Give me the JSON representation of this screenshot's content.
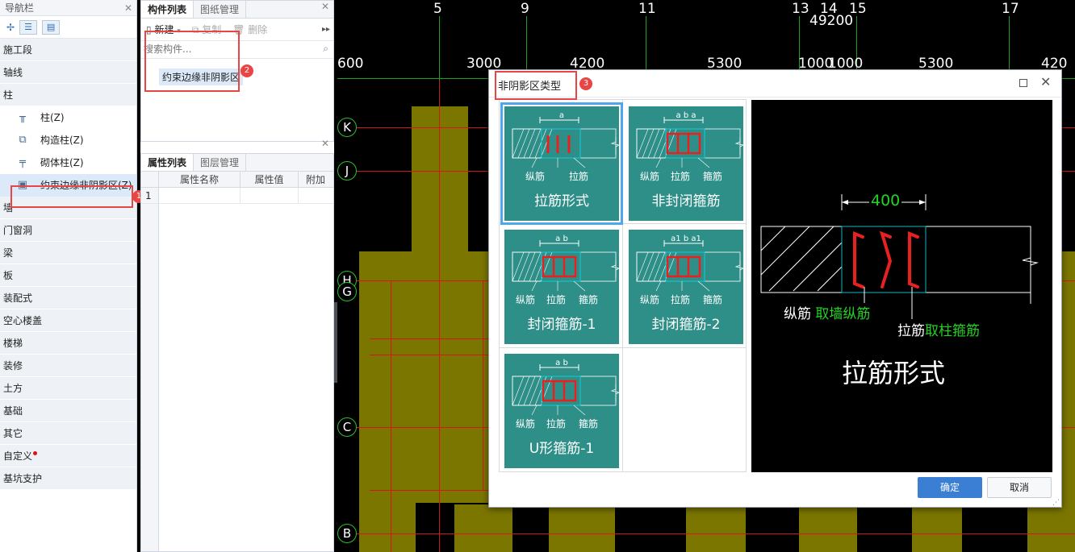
{
  "nav": {
    "title": "导航栏",
    "categories_top": [
      "施工段",
      "轴线",
      "柱"
    ],
    "sub_items": [
      "柱(Z)",
      "构造柱(Z)",
      "砌体柱(Z)",
      "约束边缘非阴影区(Z)"
    ],
    "categories_bottom": [
      "墙",
      "门窗洞",
      "梁",
      "板",
      "装配式",
      "空心楼盖",
      "楼梯",
      "装修",
      "土方",
      "基础",
      "其它",
      "自定义",
      "基坑支护"
    ]
  },
  "component_panel": {
    "tabs": [
      "构件列表",
      "图纸管理"
    ],
    "new_label": "新建",
    "copy_label": "复制",
    "delete_label": "删除",
    "search_placeholder": "搜索构件...",
    "item": "约束边缘非阴影区"
  },
  "property_panel": {
    "tabs": [
      "属性列表",
      "图层管理"
    ],
    "columns": [
      "属性名称",
      "属性值",
      "附加"
    ],
    "row_num": "1"
  },
  "badges": [
    "1",
    "2",
    "3"
  ],
  "cad": {
    "top_axes": [
      "5",
      "9",
      "11",
      "13",
      "14",
      "15",
      "17"
    ],
    "top_total": "49200",
    "dims": [
      "600",
      "3000",
      "4200",
      "5300",
      "1000",
      "1000",
      "5300",
      "420"
    ],
    "left_axes": [
      "K",
      "J",
      "H",
      "G",
      "C",
      "B"
    ]
  },
  "dialog": {
    "title": "非阴影区类型",
    "cards": [
      {
        "label": "拉筋形式",
        "dim": "a",
        "parts": [
          "纵筋",
          "拉筋"
        ]
      },
      {
        "label": "非封闭箍筋",
        "dim": "a b a",
        "parts": [
          "纵筋",
          "拉筋",
          "箍筋"
        ]
      },
      {
        "label": "封闭箍筋-1",
        "dim": "a b",
        "parts": [
          "纵筋",
          "拉筋",
          "箍筋"
        ]
      },
      {
        "label": "封闭箍筋-2",
        "dim": "a1 b a1",
        "parts": [
          "纵筋",
          "拉筋",
          "箍筋"
        ]
      },
      {
        "label": "U形箍筋-1",
        "dim": "a b",
        "parts": [
          "纵筋",
          "拉筋",
          "箍筋"
        ]
      }
    ],
    "preview": {
      "dim": "400",
      "zong": "纵筋",
      "zong_src": "取墙纵筋",
      "la": "拉筋",
      "la_src": "取柱箍筋",
      "caption": "拉筋形式"
    },
    "ok": "确定",
    "cancel": "取消"
  },
  "colors": {
    "accent": "#2e8f88",
    "highlight": "#e84545",
    "primary_button": "#3b7fd4"
  }
}
